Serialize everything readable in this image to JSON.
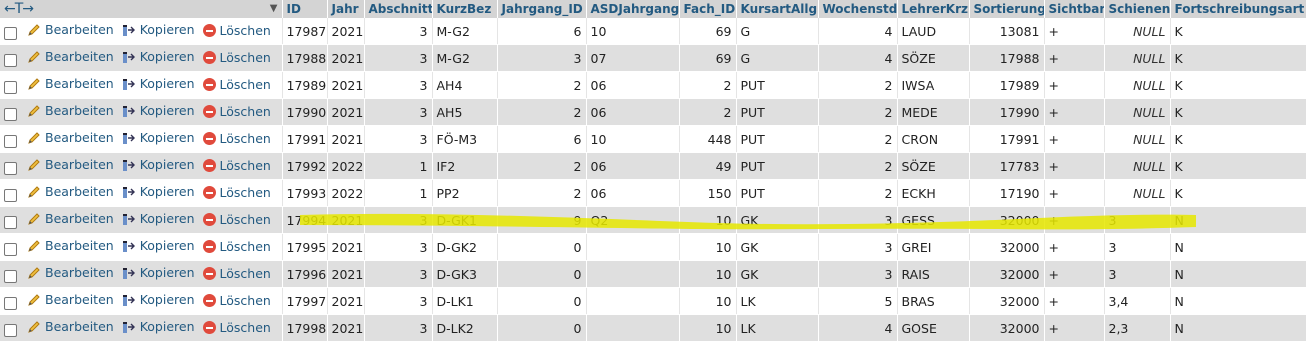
{
  "header": {
    "arrows": "←T→",
    "columns": [
      "ID",
      "Jahr",
      "Abschnitt",
      "KurzBez",
      "Jahrgang_ID",
      "ASDJahrgang",
      "Fach_ID",
      "KursartAllg",
      "Wochenstd",
      "LehrerKrz",
      "Sortierung",
      "Sichtbar",
      "Schienen",
      "Fortschreibungsart"
    ]
  },
  "actions": {
    "edit": "Bearbeiten",
    "copy": "Kopieren",
    "delete": "Löschen"
  },
  "rows": [
    [
      "17987",
      "2021",
      "3",
      "M-G2",
      "6",
      "10",
      "69",
      "G",
      "4",
      "LAUD",
      "13081",
      "+",
      "NULL",
      "K"
    ],
    [
      "17988",
      "2021",
      "3",
      "M-G2",
      "3",
      "07",
      "69",
      "G",
      "4",
      "SÖZE",
      "17988",
      "+",
      "NULL",
      "K"
    ],
    [
      "17989",
      "2021",
      "3",
      "AH4",
      "2",
      "06",
      "2",
      "PUT",
      "2",
      "IWSA",
      "17989",
      "+",
      "NULL",
      "K"
    ],
    [
      "17990",
      "2021",
      "3",
      "AH5",
      "2",
      "06",
      "2",
      "PUT",
      "2",
      "MEDE",
      "17990",
      "+",
      "NULL",
      "K"
    ],
    [
      "17991",
      "2021",
      "3",
      "FÖ-M3",
      "6",
      "10",
      "448",
      "PUT",
      "2",
      "CRON",
      "17991",
      "+",
      "NULL",
      "K"
    ],
    [
      "17992",
      "2022",
      "1",
      "IF2",
      "2",
      "06",
      "49",
      "PUT",
      "2",
      "SÖZE",
      "17783",
      "+",
      "NULL",
      "K"
    ],
    [
      "17993",
      "2022",
      "1",
      "PP2",
      "2",
      "06",
      "150",
      "PUT",
      "2",
      "ECKH",
      "17190",
      "+",
      "NULL",
      "K"
    ],
    [
      "17994",
      "2021",
      "3",
      "D-GK1",
      "9",
      "Q2",
      "10",
      "GK",
      "3",
      "GESS",
      "32000",
      "+",
      "3",
      "N"
    ],
    [
      "17995",
      "2021",
      "3",
      "D-GK2",
      "0",
      "",
      "10",
      "GK",
      "3",
      "GREI",
      "32000",
      "+",
      "3",
      "N"
    ],
    [
      "17996",
      "2021",
      "3",
      "D-GK3",
      "0",
      "",
      "10",
      "GK",
      "3",
      "RAIS",
      "32000",
      "+",
      "3",
      "N"
    ],
    [
      "17997",
      "2021",
      "3",
      "D-LK1",
      "0",
      "",
      "10",
      "LK",
      "5",
      "BRAS",
      "32000",
      "+",
      "3,4",
      "N"
    ],
    [
      "17998",
      "2021",
      "3",
      "D-LK2",
      "0",
      "",
      "10",
      "LK",
      "4",
      "GOSE",
      "32000",
      "+",
      "2,3",
      "N"
    ]
  ],
  "colors": {
    "header_bg": "#d4d4d4",
    "link": "#235a81",
    "row_alt": "#dfdfdf",
    "highlight": "#e6e800",
    "delete_icon": "#e04a3c"
  },
  "icons": {
    "edit": "pencil-icon",
    "copy": "copy-icon",
    "delete": "delete-icon",
    "sort": "chevron-down-icon"
  }
}
